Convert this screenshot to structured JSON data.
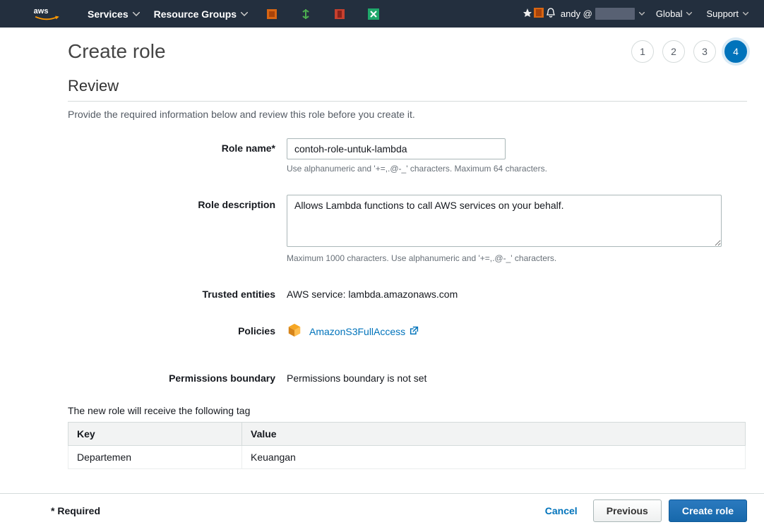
{
  "nav": {
    "services_label": "Services",
    "resource_groups_label": "Resource Groups",
    "user_prefix": "andy @",
    "region_label": "Global",
    "support_label": "Support"
  },
  "page": {
    "title": "Create role",
    "steps": [
      "1",
      "2",
      "3",
      "4"
    ],
    "active_step_index": 3
  },
  "review": {
    "heading": "Review",
    "subheading": "Provide the required information below and review this role before you create it.",
    "role_name_label": "Role name*",
    "role_name_value": "contoh-role-untuk-lambda",
    "role_name_hint": "Use alphanumeric and '+=,.@-_' characters. Maximum 64 characters.",
    "role_desc_label": "Role description",
    "role_desc_value": "Allows Lambda functions to call AWS services on your behalf.",
    "role_desc_hint": "Maximum 1000 characters. Use alphanumeric and '+=,.@-_' characters.",
    "trusted_label": "Trusted entities",
    "trusted_value": "AWS service: lambda.amazonaws.com",
    "policies_label": "Policies",
    "policy_name": "AmazonS3FullAccess",
    "perm_boundary_label": "Permissions boundary",
    "perm_boundary_value": "Permissions boundary is not set",
    "tags_intro": "The new role will receive the following tag",
    "tags_headers": {
      "key": "Key",
      "value": "Value"
    },
    "tags_rows": [
      {
        "key": "Departemen",
        "value": "Keuangan"
      }
    ]
  },
  "footer": {
    "required_note": "* Required",
    "cancel": "Cancel",
    "previous": "Previous",
    "create": "Create role"
  },
  "colors": {
    "accent": "#0073bb",
    "navbar": "#232f3e",
    "aws_orange": "#ff9900"
  }
}
